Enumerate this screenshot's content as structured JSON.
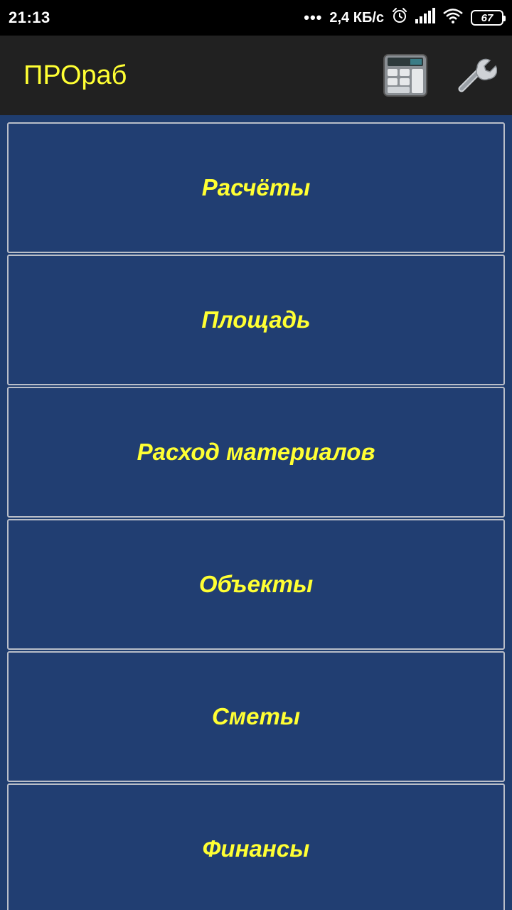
{
  "status_bar": {
    "time": "21:13",
    "dots": "•••",
    "network_speed": "2,4 КБ/с",
    "battery_level": "67",
    "icons": [
      "alarm-icon",
      "signal-icon",
      "wifi-icon",
      "battery-icon"
    ]
  },
  "toolbar": {
    "title": "ПРОраб",
    "calculator_icon": "calculator-icon",
    "settings_icon": "wrench-icon"
  },
  "menu": {
    "items": [
      {
        "label": "Расчёты"
      },
      {
        "label": "Площадь"
      },
      {
        "label": "Расход материалов"
      },
      {
        "label": "Объекты"
      },
      {
        "label": "Сметы"
      },
      {
        "label": "Финансы"
      }
    ]
  },
  "colors": {
    "accent_text": "#ffff33",
    "background": "#1f3d6f",
    "toolbar": "#212121",
    "item_border": "#b9bec8"
  }
}
